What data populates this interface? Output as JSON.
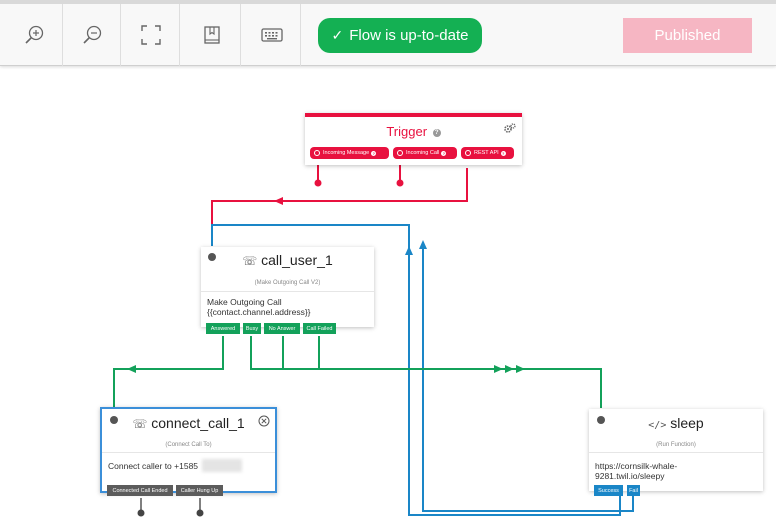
{
  "toolbar": {
    "buttons": [
      {
        "name": "zoom-in-button",
        "icon": "zoom-in-icon"
      },
      {
        "name": "zoom-out-button",
        "icon": "zoom-out-icon"
      },
      {
        "name": "fit-screen-button",
        "icon": "fit-screen-icon"
      },
      {
        "name": "bookmark-button",
        "icon": "bookmark-icon"
      },
      {
        "name": "keyboard-button",
        "icon": "keyboard-icon"
      }
    ],
    "status_check": "✓",
    "status_text": "Flow is up-to-date",
    "publish_label": "Published"
  },
  "colors": {
    "trigger_red": "#e8113f",
    "connection_green": "#13a15a",
    "connection_blue": "#1a86c7",
    "status_green": "#14b053",
    "published_pink": "#f6b6c3"
  },
  "trigger": {
    "title": "Trigger",
    "help": "?",
    "settings_icon": "gears-icon",
    "ports": [
      "Incoming Message",
      "Incoming Call",
      "REST API"
    ]
  },
  "call_user": {
    "icon": "phone-icon",
    "title": "call_user_1",
    "subtitle": "(Make Outgoing Call V2)",
    "body_line1": "Make Outgoing Call",
    "body_line2": "{{contact.channel.address}}",
    "ports": [
      "Answered",
      "Busy",
      "No Answer",
      "Call Failed"
    ]
  },
  "connect_call": {
    "icon": "phone-icon",
    "title": "connect_call_1",
    "subtitle": "(Connect Call To)",
    "body": "Connect caller to +1585",
    "close_icon": "close-circle-icon",
    "ports": [
      "Connected Call Ended",
      "Caller Hung Up"
    ]
  },
  "sleep": {
    "icon": "code-icon",
    "title": "sleep",
    "subtitle": "(Run Function)",
    "body_line1": "https://cornsilk-whale-",
    "body_line2": "9281.twil.io/sleepy",
    "ports": [
      "Success",
      "Fail"
    ]
  }
}
